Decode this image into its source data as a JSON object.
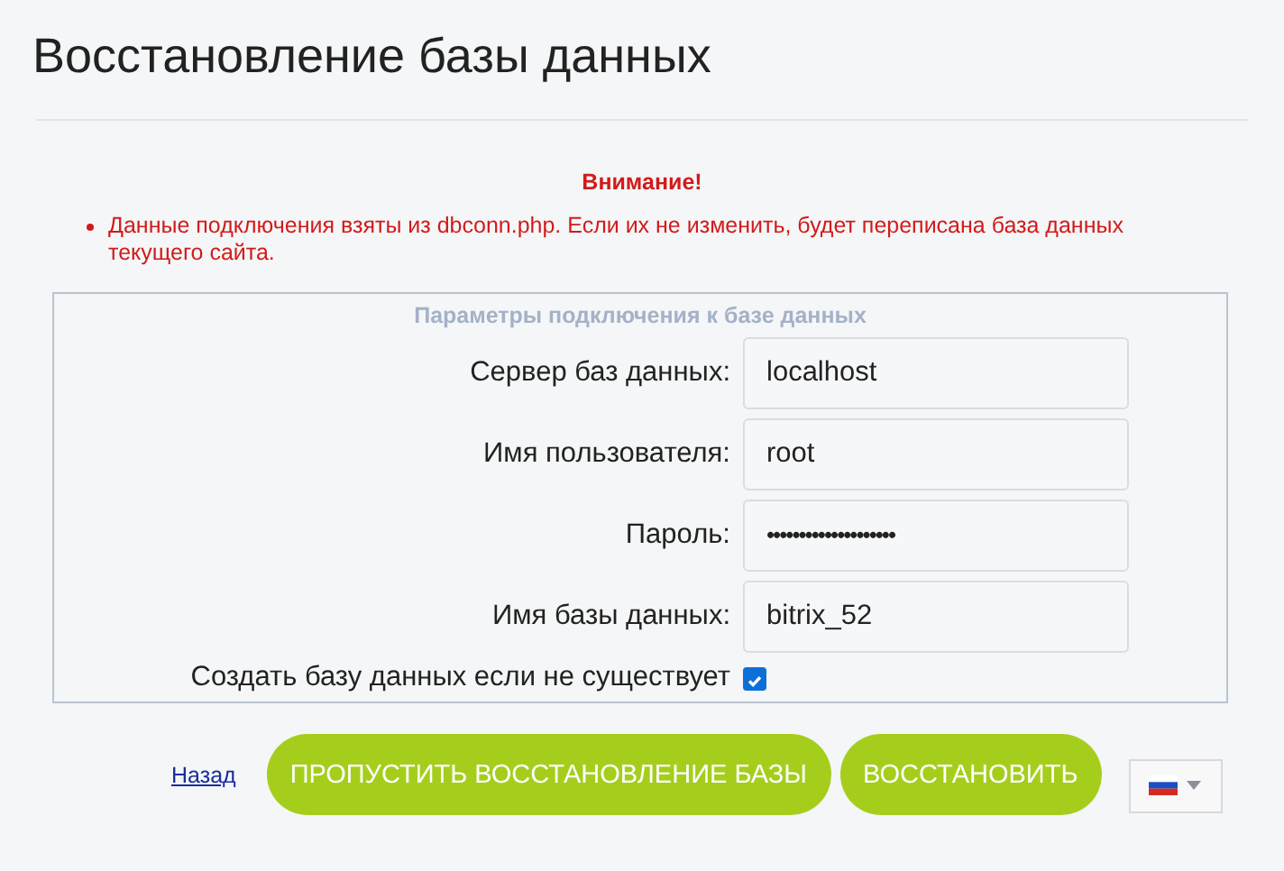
{
  "title": "Восстановление базы данных",
  "warning": {
    "heading": "Внимание!",
    "items": [
      "Данные подключения взяты из dbconn.php. Если их не изменить, будет переписана база данных текущего сайта."
    ]
  },
  "connection": {
    "legend": "Параметры подключения к базе данных",
    "fields": [
      {
        "label": "Сервер баз данных:",
        "kind": "text",
        "value": "localhost"
      },
      {
        "label": "Имя пользователя:",
        "kind": "text",
        "value": "root"
      },
      {
        "label": "Пароль:",
        "kind": "password",
        "value": "••••••••••••••••••••"
      },
      {
        "label": "Имя базы данных:",
        "kind": "text",
        "value": "bitrix_52"
      }
    ],
    "create_db": {
      "label": "Создать базу данных если не существует",
      "checked": true
    }
  },
  "back_link": "Назад",
  "buttons": [
    "ПРОПУСТИТЬ ВОССТАНОВЛЕНИЕ БАЗЫ",
    "ВОССТАНОВИТЬ"
  ]
}
